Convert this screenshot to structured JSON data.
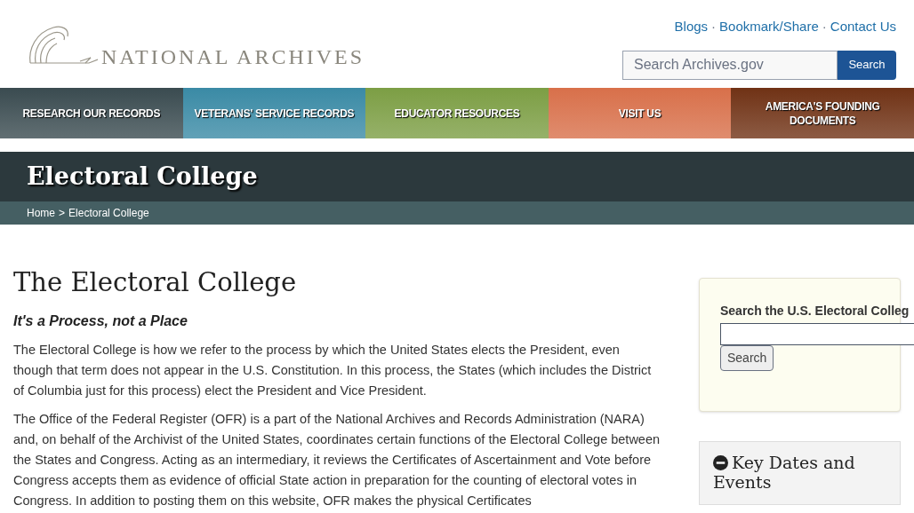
{
  "top_links": [
    "Blogs",
    "Bookmark/Share",
    "Contact Us"
  ],
  "top_link_separator": "·",
  "logo": {
    "text": "NATIONAL ARCHIVES"
  },
  "site_search": {
    "placeholder": "Search Archives.gov",
    "button": "Search"
  },
  "nav": [
    {
      "label": "RESEARCH OUR RECORDS",
      "color": "#3a4b50"
    },
    {
      "label": "VETERANS' SERVICE RECORDS",
      "color": "#3a8aa5"
    },
    {
      "label": "EDUCATOR RESOURCES",
      "color": "#7c9e44"
    },
    {
      "label": "VISIT US",
      "color": "#d8704a"
    },
    {
      "label": "AMERICA'S FOUNDING DOCUMENTS",
      "color": "#703215"
    }
  ],
  "page_title": "Electoral College",
  "breadcrumb": {
    "separator": ">",
    "items": [
      "Home",
      "Electoral College"
    ]
  },
  "article": {
    "heading": "The Electoral College",
    "subheading": "It's a Process, not a Place",
    "paragraphs": [
      "The Electoral College is how we refer to the process by which the United States elects the President, even though that term does not appear in the U.S. Constitution.  In this process, the States (which includes the District of Columbia just for this process) elect the President and Vice President.",
      "The Office of the Federal Register (OFR) is a part of the National Archives and Records Administration (NARA) and, on behalf of the Archivist of the United States, coordinates certain functions of the Electoral College between the States and Congress. Acting as an intermediary, it reviews the Certificates of Ascertainment and Vote before Congress accepts them as evidence of official State action in preparation for the counting of electoral votes in Congress. In addition to posting them on this website, OFR makes the physical Certificates"
    ]
  },
  "sidebar": {
    "search_label": "Search the U.S. Electoral Colleg",
    "search_button": "Search",
    "accordion": {
      "title": "Key Dates and Events",
      "expanded": true
    }
  }
}
